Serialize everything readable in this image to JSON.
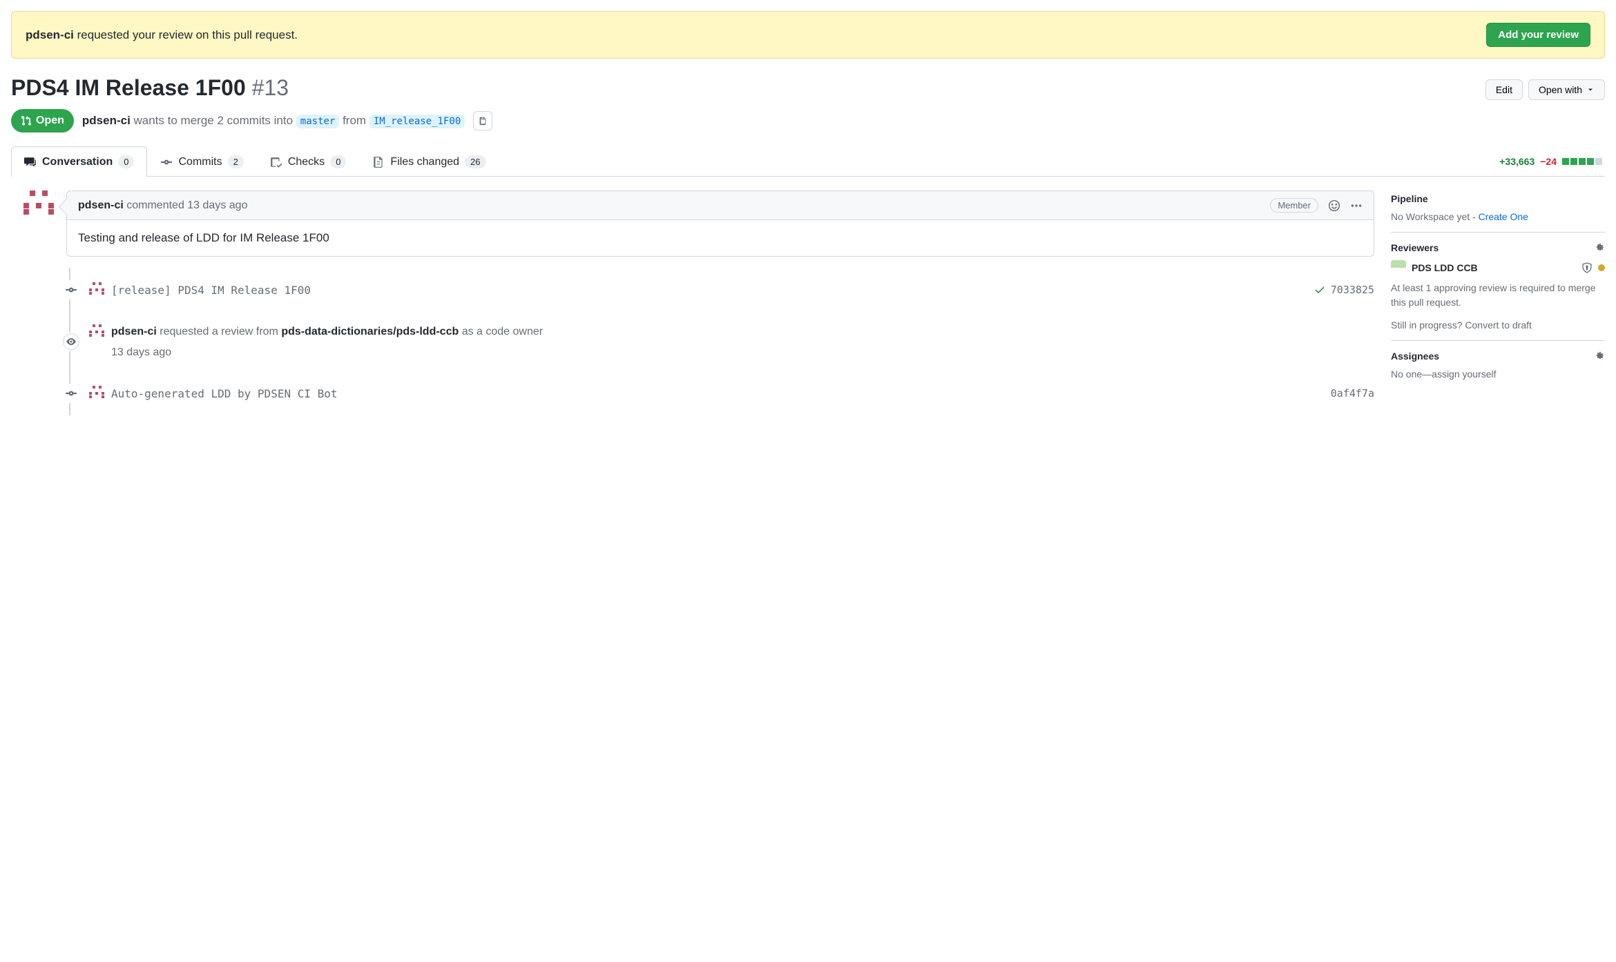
{
  "banner": {
    "requester": "pdsen-ci",
    "text": " requested your review on this pull request.",
    "button": "Add your review"
  },
  "title": {
    "name": "PDS4 IM Release 1F00",
    "number": "#13",
    "edit": "Edit",
    "openWith": "Open with"
  },
  "meta": {
    "state": "Open",
    "author": "pdsen-ci",
    "desc1": " wants to merge 2 commits into ",
    "base": "master",
    "desc2": " from ",
    "head": "IM_release_1F00"
  },
  "tabs": {
    "conversation": {
      "label": "Conversation",
      "count": "0"
    },
    "commits": {
      "label": "Commits",
      "count": "2"
    },
    "checks": {
      "label": "Checks",
      "count": "0"
    },
    "files": {
      "label": "Files changed",
      "count": "26"
    }
  },
  "diffstat": {
    "add": "+33,663",
    "del": "−24"
  },
  "comment": {
    "author": "pdsen-ci",
    "meta": " commented 13 days ago",
    "role": "Member",
    "body": "Testing and release of LDD for IM Release 1F00"
  },
  "timeline": {
    "commit1": {
      "msg": "[release] PDS4 IM Release 1F00",
      "sha": "7033825"
    },
    "review": {
      "author": "pdsen-ci",
      "mid": " requested a review from ",
      "team": "pds-data-dictionaries/pds-ldd-ccb",
      "tail": " as a code owner",
      "time": "13 days ago"
    },
    "commit2": {
      "msg": "Auto-generated LDD by PDSEN CI Bot",
      "sha": "0af4f7a"
    }
  },
  "sidebar": {
    "pipeline": {
      "title": "Pipeline",
      "text": "No Workspace yet - ",
      "link": "Create One"
    },
    "reviewers": {
      "title": "Reviewers",
      "name": "PDS LDD CCB",
      "note": "At least 1 approving review is required to merge this pull request.",
      "draft1": "Still in progress? ",
      "draft2": "Convert to draft"
    },
    "assignees": {
      "title": "Assignees",
      "text": "No one—",
      "link": "assign yourself"
    }
  }
}
